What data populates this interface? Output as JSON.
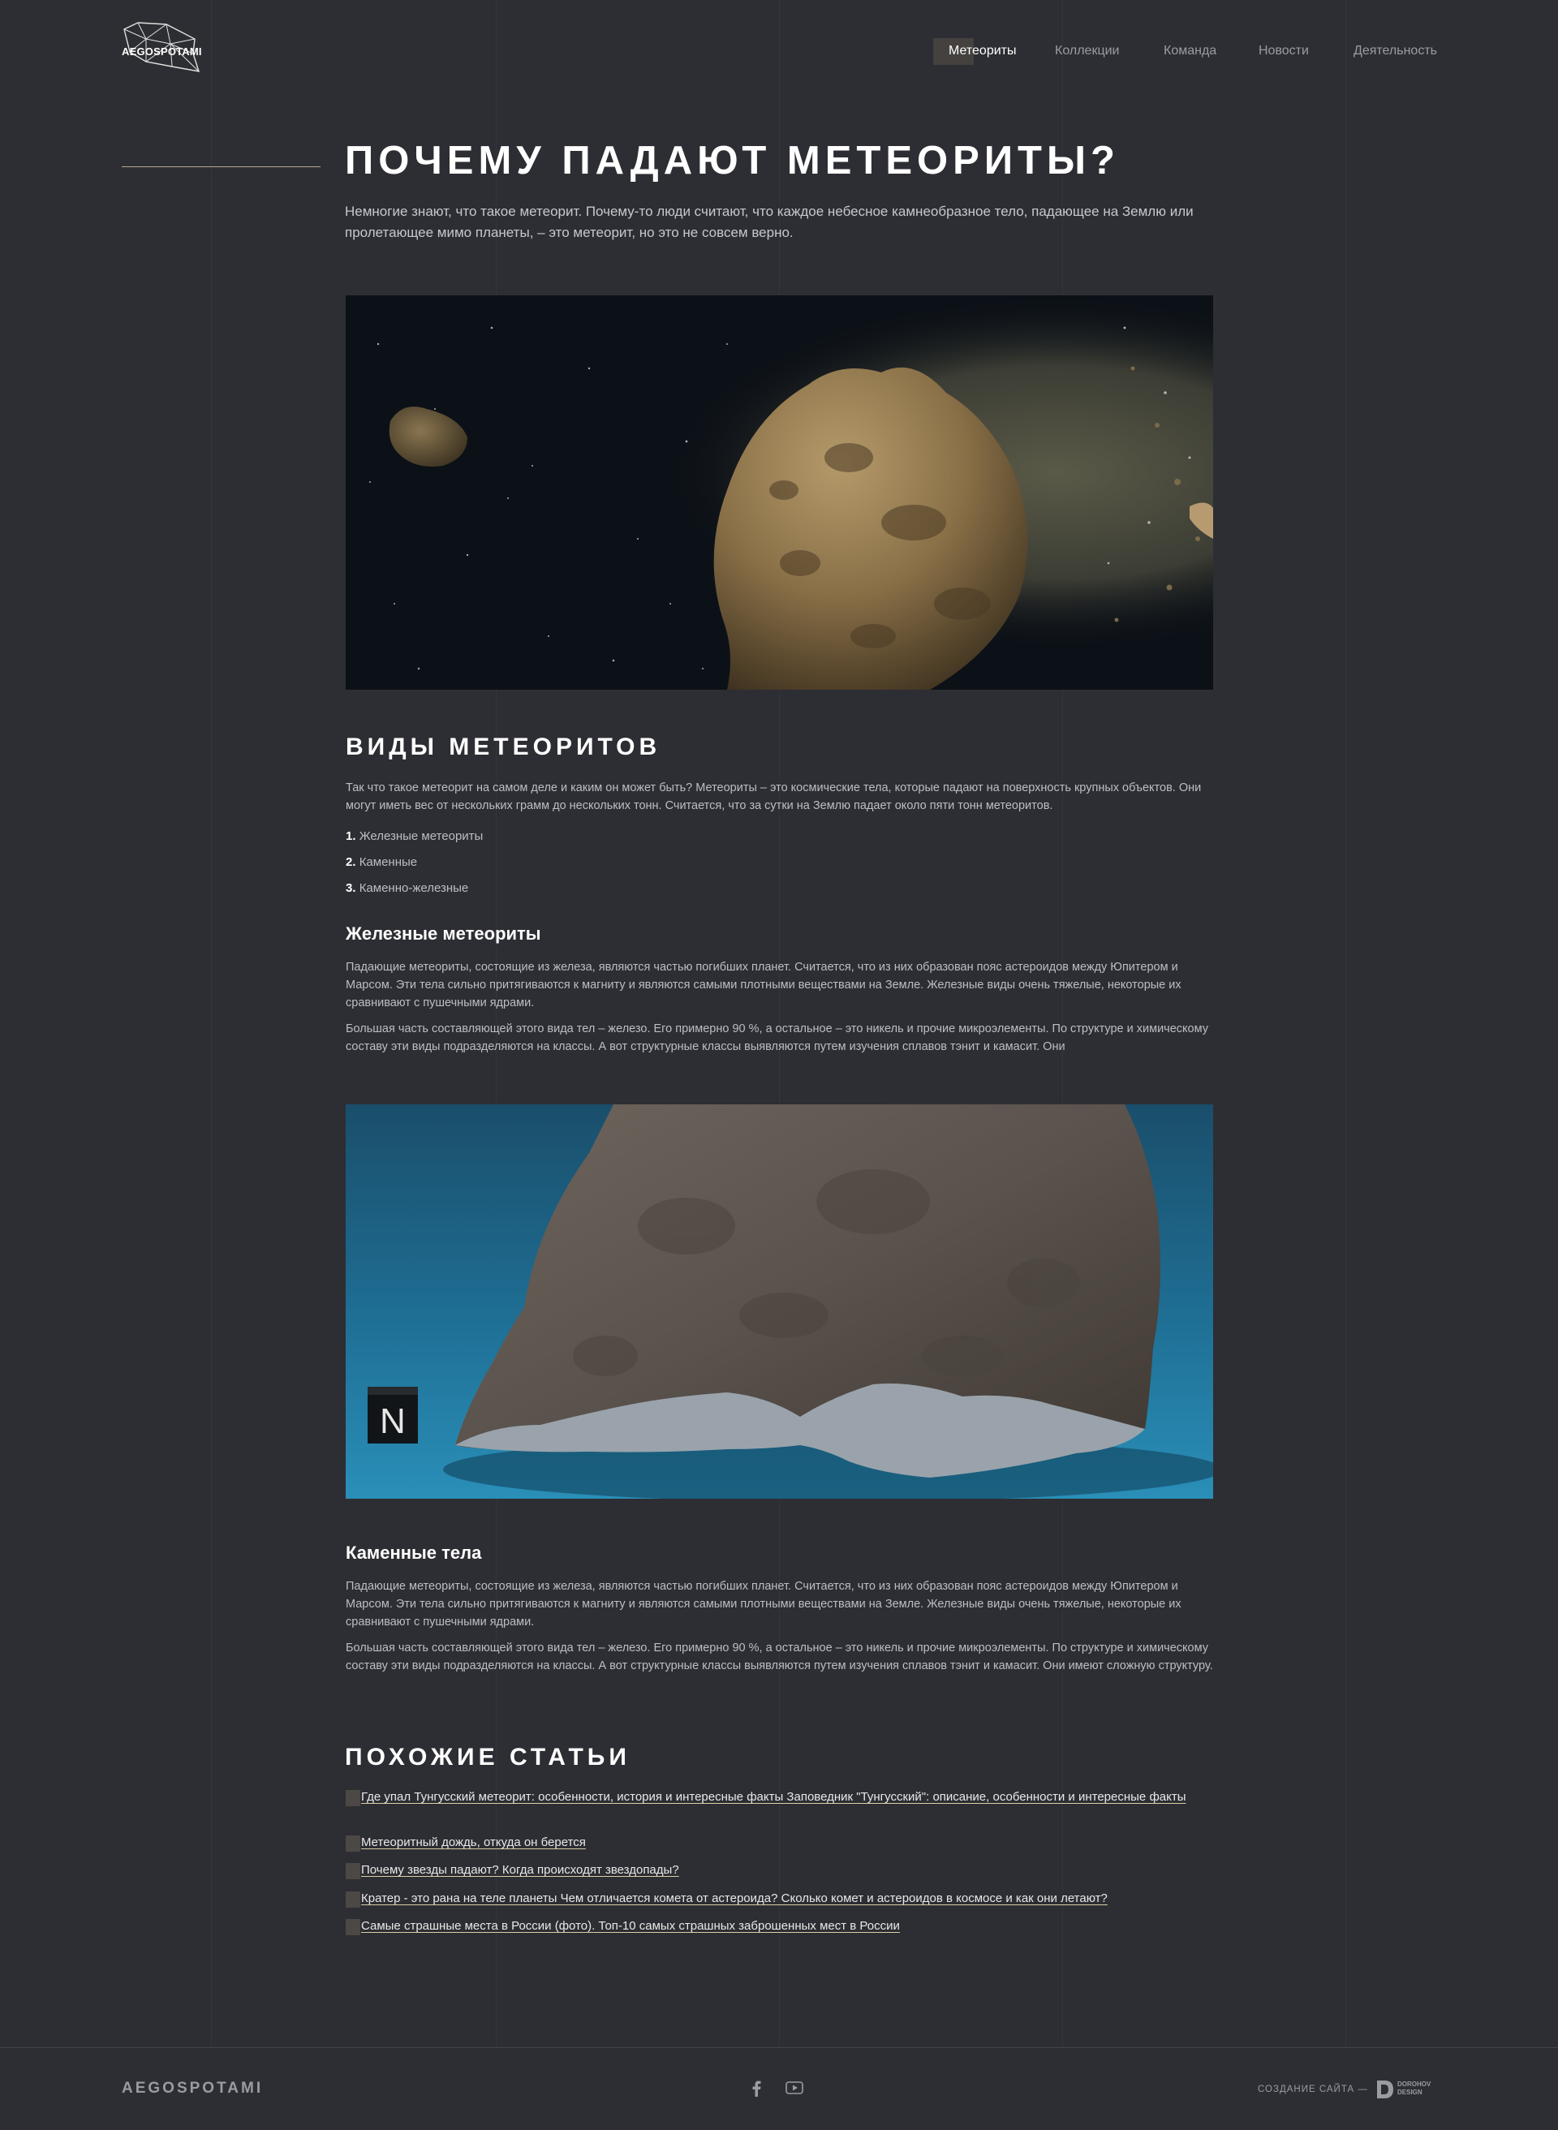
{
  "header": {
    "logo_text": "AEGOSPOTAMI",
    "nav": [
      {
        "label": "Метеориты",
        "active": true
      },
      {
        "label": "Коллекции",
        "active": false
      },
      {
        "label": "Команда",
        "active": false
      },
      {
        "label": "Новости",
        "active": false
      },
      {
        "label": "Деятельность",
        "active": false
      }
    ]
  },
  "hero": {
    "title": "ПОЧЕМУ ПАДАЮТ МЕТЕОРИТЫ?",
    "lead": "Немногие знают, что такое метеорит. Почему-то люди считают, что каждое небесное камнеобразное тело, падающее на Землю или пролетающее мимо планеты, – это метеорит, но это не совсем верно."
  },
  "types": {
    "title": "ВИДЫ МЕТЕОРИТОВ",
    "intro": "Так что такое метеорит на самом деле и каким он может быть? Метеориты – это космические тела, которые падают на поверхность крупных объектов. Они могут иметь вес от нескольких грамм до нескольких тонн. Считается, что за сутки на Землю падает около пяти тонн метеоритов.",
    "list": [
      {
        "num": "1.",
        "label": "Железные метеориты"
      },
      {
        "num": "2.",
        "label": "Каменные"
      },
      {
        "num": "3.",
        "label": "Каменно-железные"
      }
    ]
  },
  "iron": {
    "title": "Железные метеориты",
    "p1": "Падающие метеориты, состоящие из железа, являются частью погибших планет. Считается, что из них образован пояс астероидов между Юпитером и Марсом. Эти тела сильно притягиваются к магниту и являются самыми плотными веществами на Земле. Железные виды очень тяжелые, некоторые их сравнивают с пушечными ядрами.",
    "p2": "Большая часть составляющей этого вида тел – железо. Его примерно 90 %, а остальное – это никель и прочие микроэлементы. По структуре и химическому составу эти виды подразделяются на классы. А вот структурные классы выявляются путем изучения сплавов тэнит и камасит. Они"
  },
  "stone": {
    "title": "Каменные тела",
    "p1": "Падающие метеориты, состоящие из железа, являются частью погибших планет. Считается, что из них образован пояс астероидов между Юпитером и Марсом. Эти тела сильно притягиваются к магниту и являются самыми плотными веществами на Земле. Железные виды очень тяжелые, некоторые их сравнивают с пушечными ядрами.",
    "p2": "Большая часть составляющей этого вида тел – железо. Его примерно 90 %, а остальное – это никель и прочие микроэлементы. По структуре и химическому составу эти виды подразделяются на классы. А вот структурные классы выявляются путем изучения сплавов тэнит и камасит. Они имеют сложную структуру."
  },
  "related": {
    "title": "ПОХОЖИЕ СТАТЬИ",
    "items": [
      "Где упал Тунгусский метеорит: особенности, история и интересные факты Заповедник \"Тунгусский\": описание, особенности и интересные факты",
      "Метеоритный дождь, откуда он берется",
      "Почему звезды падают? Когда происходят звездопады?",
      "Кратер - это рана на теле планеты Чем отличается комета от астероида? Сколько комет и астероидов в космосе и как они летают?",
      "Самые страшные места в России (фото). Топ-10 самых страшных заброшенных мест в России"
    ]
  },
  "images": {
    "hero_label": "asteroid-in-space-image",
    "specimen_label": "iron-meteorite-specimen-image",
    "cube_letter": "N"
  },
  "footer": {
    "brand": "AEGOSPOTAMI",
    "credit": "СОЗДАНИЕ САЙТА —",
    "studio_line1": "DOROHOV",
    "studio_line2": "DESIGN",
    "social": [
      "facebook-icon",
      "youtube-icon"
    ]
  }
}
